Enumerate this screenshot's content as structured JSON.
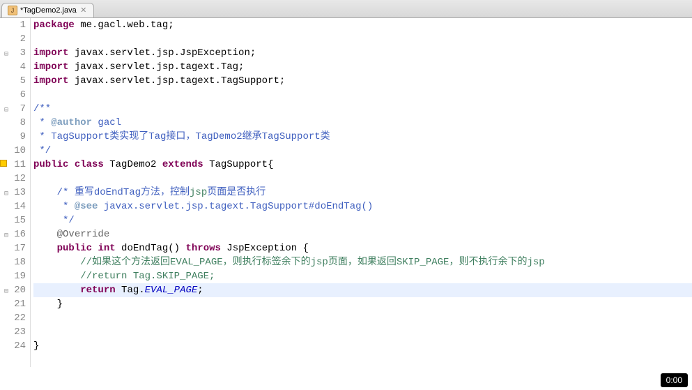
{
  "tab": {
    "label": "*TagDemo2.java",
    "icon_glyph": "J"
  },
  "timer": "0:00",
  "lines": [
    {
      "num": 1,
      "marker": "",
      "tokens": [
        {
          "c": "kw",
          "t": "package"
        },
        {
          "c": "",
          "t": " me.gacl.web.tag;"
        }
      ]
    },
    {
      "num": 2,
      "marker": "",
      "tokens": []
    },
    {
      "num": 3,
      "marker": "fold",
      "tokens": [
        {
          "c": "kw",
          "t": "import"
        },
        {
          "c": "",
          "t": " javax.servlet.jsp.JspException;"
        }
      ]
    },
    {
      "num": 4,
      "marker": "",
      "tokens": [
        {
          "c": "kw",
          "t": "import"
        },
        {
          "c": "",
          "t": " javax.servlet.jsp.tagext.Tag;"
        }
      ]
    },
    {
      "num": 5,
      "marker": "",
      "tokens": [
        {
          "c": "kw",
          "t": "import"
        },
        {
          "c": "",
          "t": " javax.servlet.jsp.tagext.TagSupport;"
        }
      ]
    },
    {
      "num": 6,
      "marker": "",
      "tokens": []
    },
    {
      "num": 7,
      "marker": "fold",
      "tokens": [
        {
          "c": "jd",
          "t": "/**"
        }
      ]
    },
    {
      "num": 8,
      "marker": "",
      "tokens": [
        {
          "c": "jd",
          "t": " * "
        },
        {
          "c": "jdtag",
          "t": "@author"
        },
        {
          "c": "jd",
          "t": " gacl"
        }
      ]
    },
    {
      "num": 9,
      "marker": "",
      "tokens": [
        {
          "c": "jd",
          "t": " * TagSupport类实现了Tag接口，TagDemo2继承TagSupport类"
        }
      ]
    },
    {
      "num": 10,
      "marker": "",
      "tokens": [
        {
          "c": "jd",
          "t": " */"
        }
      ]
    },
    {
      "num": 11,
      "marker": "warn",
      "tokens": [
        {
          "c": "kw",
          "t": "public"
        },
        {
          "c": "",
          "t": " "
        },
        {
          "c": "kw",
          "t": "class"
        },
        {
          "c": "",
          "t": " TagDemo2 "
        },
        {
          "c": "kw",
          "t": "extends"
        },
        {
          "c": "",
          "t": " TagSupport{"
        }
      ]
    },
    {
      "num": 12,
      "marker": "",
      "tokens": []
    },
    {
      "num": 13,
      "marker": "fold",
      "tokens": [
        {
          "c": "",
          "t": "    "
        },
        {
          "c": "jd",
          "t": "/* 重写doEndTag方法，控制"
        },
        {
          "c": "cm",
          "t": "jsp"
        },
        {
          "c": "jd",
          "t": "页面是否执行"
        }
      ]
    },
    {
      "num": 14,
      "marker": "",
      "tokens": [
        {
          "c": "",
          "t": "    "
        },
        {
          "c": "jd",
          "t": " * "
        },
        {
          "c": "jdtag",
          "t": "@see"
        },
        {
          "c": "jd",
          "t": " javax.servlet.jsp.tagext.TagSupport#doEndTag()"
        }
      ]
    },
    {
      "num": 15,
      "marker": "",
      "tokens": [
        {
          "c": "",
          "t": "    "
        },
        {
          "c": "jd",
          "t": " */"
        }
      ]
    },
    {
      "num": 16,
      "marker": "fold",
      "tokens": [
        {
          "c": "",
          "t": "    "
        },
        {
          "c": "ann",
          "t": "@Override"
        }
      ]
    },
    {
      "num": 17,
      "marker": "",
      "tokens": [
        {
          "c": "",
          "t": "    "
        },
        {
          "c": "kw",
          "t": "public"
        },
        {
          "c": "",
          "t": " "
        },
        {
          "c": "kw",
          "t": "int"
        },
        {
          "c": "",
          "t": " doEndTag() "
        },
        {
          "c": "kw",
          "t": "throws"
        },
        {
          "c": "",
          "t": " JspException {"
        }
      ]
    },
    {
      "num": 18,
      "marker": "",
      "tokens": [
        {
          "c": "",
          "t": "        "
        },
        {
          "c": "cm",
          "t": "//如果这个方法返回EVAL_PAGE，则执行标签余下的jsp页面，如果返回SKIP_PAGE，则不执行余下的jsp"
        }
      ]
    },
    {
      "num": 19,
      "marker": "",
      "tokens": [
        {
          "c": "",
          "t": "        "
        },
        {
          "c": "cm",
          "t": "//return Tag.SKIP_PAGE;"
        }
      ]
    },
    {
      "num": 20,
      "marker": "fold",
      "highlight": true,
      "tokens": [
        {
          "c": "",
          "t": "        "
        },
        {
          "c": "kw",
          "t": "return"
        },
        {
          "c": "",
          "t": " Tag."
        },
        {
          "c": "const",
          "t": "EVAL_PAGE"
        },
        {
          "c": "",
          "t": ";"
        }
      ]
    },
    {
      "num": 21,
      "marker": "",
      "tokens": [
        {
          "c": "",
          "t": "    }"
        }
      ]
    },
    {
      "num": 22,
      "marker": "",
      "tokens": []
    },
    {
      "num": 23,
      "marker": "",
      "tokens": []
    },
    {
      "num": 24,
      "marker": "",
      "tokens": [
        {
          "c": "",
          "t": "}"
        }
      ]
    }
  ]
}
